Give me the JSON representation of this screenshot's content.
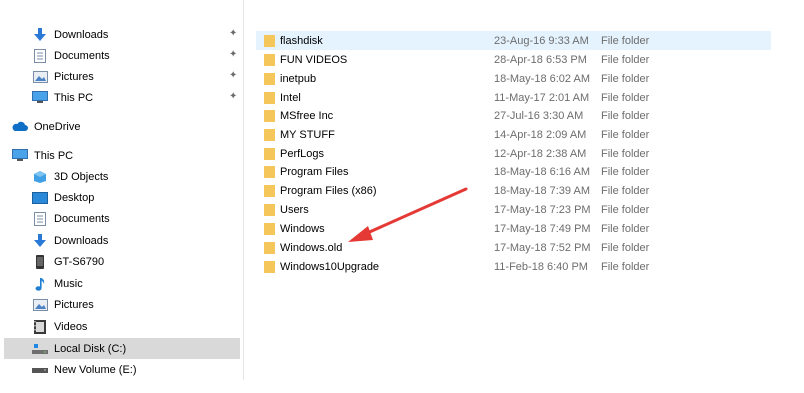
{
  "quick_access": [
    {
      "label": "Downloads",
      "icon": "download-icon",
      "pinned": true
    },
    {
      "label": "Documents",
      "icon": "document-icon",
      "pinned": true
    },
    {
      "label": "Pictures",
      "icon": "pictures-icon",
      "pinned": true
    },
    {
      "label": "This PC",
      "icon": "computer-icon",
      "pinned": true
    }
  ],
  "onedrive": {
    "label": "OneDrive",
    "icon": "cloud-icon"
  },
  "this_pc": {
    "label": "This PC",
    "icon": "computer-icon",
    "children": [
      {
        "label": "3D Objects",
        "icon": "cube-icon"
      },
      {
        "label": "Desktop",
        "icon": "desktop-icon"
      },
      {
        "label": "Documents",
        "icon": "document-icon"
      },
      {
        "label": "Downloads",
        "icon": "download-icon"
      },
      {
        "label": "GT-S6790",
        "icon": "phone-icon"
      },
      {
        "label": "Music",
        "icon": "music-icon"
      },
      {
        "label": "Pictures",
        "icon": "pictures-icon"
      },
      {
        "label": "Videos",
        "icon": "video-icon"
      },
      {
        "label": "Local Disk (C:)",
        "icon": "drive-icon",
        "selected": true
      },
      {
        "label": "New Volume (E:)",
        "icon": "drive-icon"
      }
    ]
  },
  "files": [
    {
      "name": "flashdisk",
      "date": "23-Aug-16 9:33 AM",
      "type": "File folder",
      "selected": true
    },
    {
      "name": "FUN VIDEOS",
      "date": "28-Apr-18 6:53 PM",
      "type": "File folder"
    },
    {
      "name": "inetpub",
      "date": "18-May-18 6:02 AM",
      "type": "File folder"
    },
    {
      "name": "Intel",
      "date": "11-May-17 2:01 AM",
      "type": "File folder"
    },
    {
      "name": "MSfree Inc",
      "date": "27-Jul-16 3:30 AM",
      "type": "File folder"
    },
    {
      "name": "MY STUFF",
      "date": "14-Apr-18 2:09 AM",
      "type": "File folder"
    },
    {
      "name": "PerfLogs",
      "date": "12-Apr-18 2:38 AM",
      "type": "File folder"
    },
    {
      "name": "Program Files",
      "date": "18-May-18 6:16 AM",
      "type": "File folder"
    },
    {
      "name": "Program Files (x86)",
      "date": "18-May-18 7:39 AM",
      "type": "File folder"
    },
    {
      "name": "Users",
      "date": "17-May-18 7:23 PM",
      "type": "File folder"
    },
    {
      "name": "Windows",
      "date": "17-May-18 7:49 PM",
      "type": "File folder"
    },
    {
      "name": "Windows.old",
      "date": "17-May-18 7:52 PM",
      "type": "File folder"
    },
    {
      "name": "Windows10Upgrade",
      "date": "11-Feb-18 6:40 PM",
      "type": "File folder"
    }
  ],
  "colors": {
    "folder": "#f5c65a",
    "selection": "#e5f3ff",
    "nav_selection": "#d9d9d9",
    "annotation_arrow": "#e53935"
  }
}
